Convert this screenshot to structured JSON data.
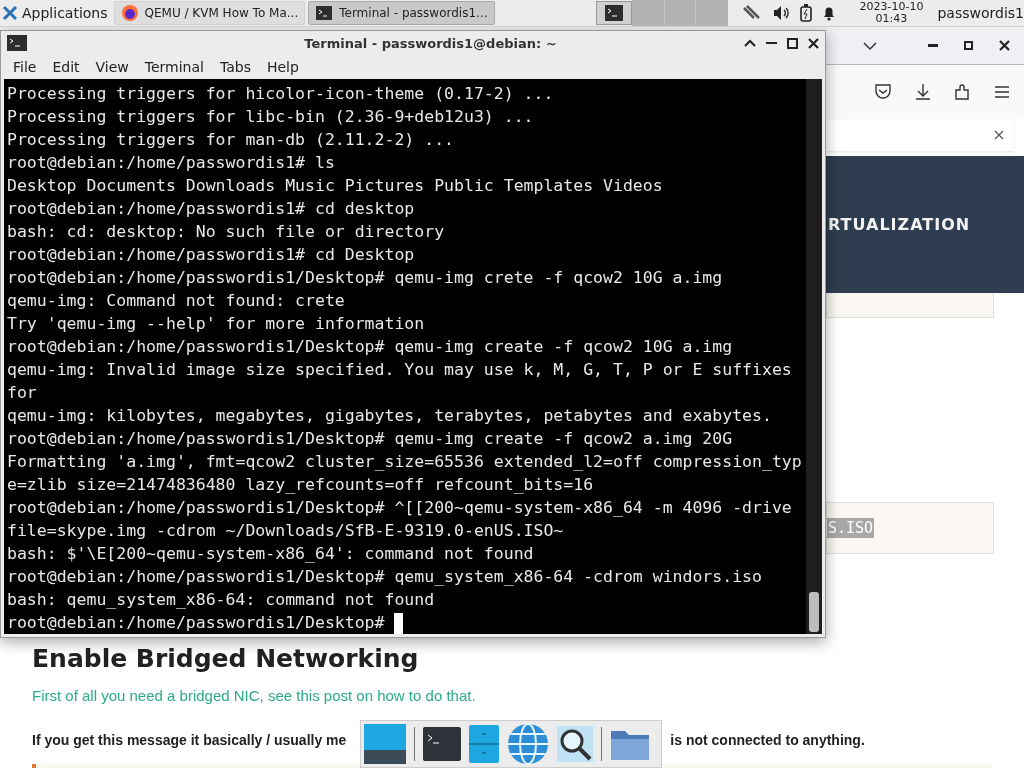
{
  "panel": {
    "apps_menu": "Applications",
    "tasks": [
      {
        "label": "QEMU / KVM How To Ma...",
        "kind": "browser",
        "selected": false
      },
      {
        "label": "Terminal - passwordis1...",
        "kind": "terminal",
        "selected": true
      }
    ],
    "clock": {
      "date": "2023-10-10",
      "time": "01:43"
    },
    "user": "passwordis1"
  },
  "terminal": {
    "title": "Terminal - passwordis1@debian: ~",
    "menu": [
      "File",
      "Edit",
      "View",
      "Terminal",
      "Tabs",
      "Help"
    ],
    "lines": [
      "Processing triggers for hicolor-icon-theme (0.17-2) ...",
      "Processing triggers for libc-bin (2.36-9+deb12u3) ...",
      "Processing triggers for man-db (2.11.2-2) ...",
      "root@debian:/home/passwordis1# ls",
      "Desktop  Documents  Downloads  Music  Pictures  Public  Templates  Videos",
      "root@debian:/home/passwordis1# cd desktop",
      "bash: cd: desktop: No such file or directory",
      "root@debian:/home/passwordis1# cd Desktop",
      "root@debian:/home/passwordis1/Desktop# qemu-img crete -f qcow2 10G a.img",
      "qemu-img: Command not found: crete",
      "Try 'qemu-img --help' for more information",
      "root@debian:/home/passwordis1/Desktop# qemu-img create -f qcow2 10G a.img",
      "qemu-img: Invalid image size specified. You may use k, M, G, T, P or E suffixes",
      "for",
      "qemu-img: kilobytes, megabytes, gigabytes, terabytes, petabytes and exabytes.",
      "root@debian:/home/passwordis1/Desktop# qemu-img create -f qcow2 a.img 20G",
      "Formatting 'a.img', fmt=qcow2 cluster_size=65536 extended_l2=off compression_typ",
      "e=zlib size=21474836480 lazy_refcounts=off refcount_bits=16",
      "root@debian:/home/passwordis1/Desktop# ^[[200~qemu-system-x86_64 -m 4096 -drive",
      "file=skype.img -cdrom ~/Downloads/SfB-E-9319.0-enUS.ISO~",
      "bash: $'\\E[200~qemu-system-x86_64': command not found",
      "root@debian:/home/passwordis1/Desktop# qemu_system_x86-64 -cdrom windors.iso",
      "bash: qemu_system_x86-64: command not found",
      "root@debian:/home/passwordis1/Desktop# "
    ]
  },
  "browser": {
    "banner_text": "RTUALIZATION",
    "code_text": "S.ISO",
    "heading": "Enable Bridged Networking",
    "link_text": "First of all you need a bridged NIC, see this post on how to do that.",
    "bold_text_start": "If you get this message it basically / usually me",
    "bold_text_end": "is not connected to anything."
  }
}
